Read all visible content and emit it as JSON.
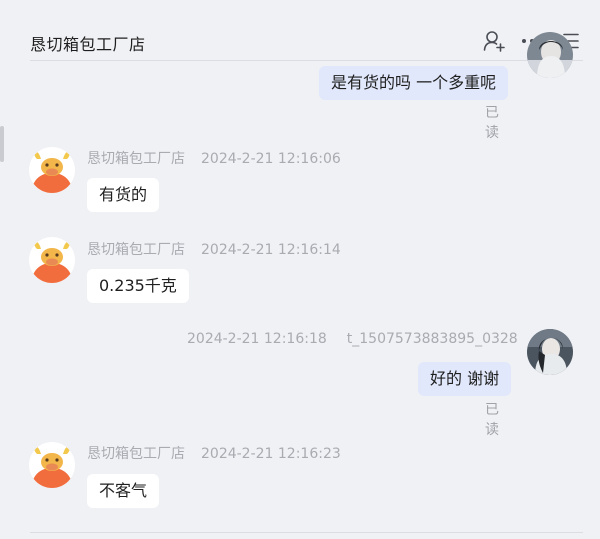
{
  "header": {
    "title": "恳切箱包工厂店",
    "icons": [
      "add-contact-icon",
      "more-icon",
      "menu-icon"
    ]
  },
  "messages": [
    {
      "direction": "out",
      "text": "是有货的吗 一个多重呢",
      "status": "已读"
    },
    {
      "direction": "in",
      "sender": "恳切箱包工厂店",
      "time": "2024-2-21 12:16:06",
      "text": "有货的"
    },
    {
      "direction": "in",
      "sender": "恳切箱包工厂店",
      "time": "2024-2-21 12:16:14",
      "text": "0.235千克"
    },
    {
      "direction": "out",
      "sender": "t_1507573883895_0328",
      "time": "2024-2-21 12:16:18",
      "text": "好的 谢谢",
      "status": "已读"
    },
    {
      "direction": "in",
      "sender": "恳切箱包工厂店",
      "time": "2024-2-21 12:16:23",
      "text": "不客气"
    }
  ],
  "colors": {
    "background": "#f0f1f5",
    "incoming_bubble": "#ffffff",
    "outgoing_bubble": "#e1e8fb",
    "meta_text": "#a9abb1"
  }
}
